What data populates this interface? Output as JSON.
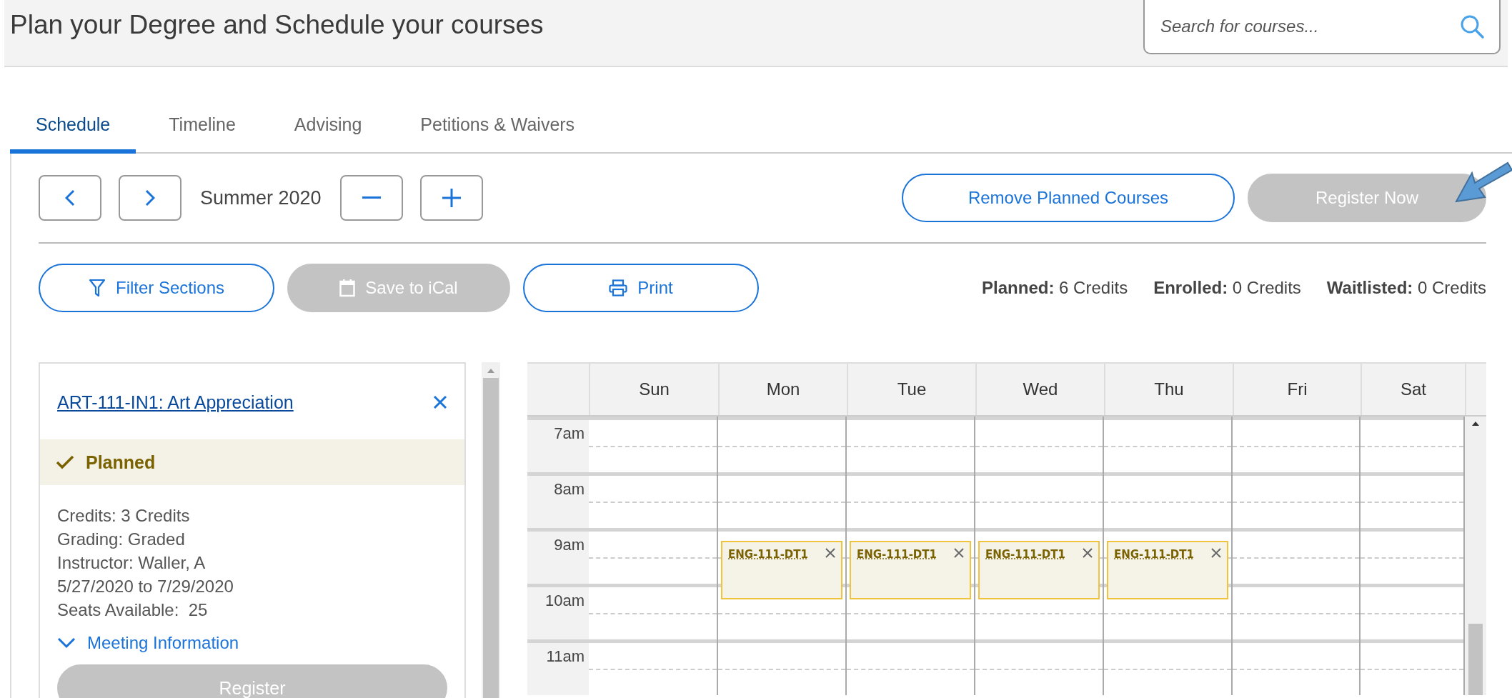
{
  "page_title": "Plan your Degree and Schedule your courses",
  "search": {
    "placeholder": "Search for courses..."
  },
  "tabs": [
    {
      "label": "Schedule",
      "selected": true
    },
    {
      "label": "Timeline",
      "selected": false
    },
    {
      "label": "Advising",
      "selected": false
    },
    {
      "label": "Petitions & Waivers",
      "selected": false
    }
  ],
  "term": "Summer 2020",
  "top_actions": [
    {
      "label": "Remove Planned Courses",
      "disabled": false
    },
    {
      "label": "Register Now",
      "disabled": true
    }
  ],
  "tools": [
    {
      "label": "Filter Sections",
      "kind": "filter",
      "disabled": false
    },
    {
      "label": "Save to iCal",
      "kind": "calendar",
      "disabled": true
    },
    {
      "label": "Print",
      "kind": "print",
      "disabled": false
    }
  ],
  "totals": [
    {
      "label": "Planned:",
      "value": "6 Credits"
    },
    {
      "label": "Enrolled:",
      "value": "0 Credits"
    },
    {
      "label": "Waitlisted:",
      "value": "0 Credits"
    }
  ],
  "course_card": {
    "title": "ART-111-IN1: Art Appreciation",
    "status": "Planned",
    "details": [
      "Credits: 3 Credits",
      "Grading: Graded",
      "Instructor: Waller, A",
      "5/27/2020 to 7/29/2020",
      "Seats Available:  25"
    ],
    "meeting_link": "Meeting Information",
    "expanded": false,
    "register": {
      "label": "Register",
      "disabled": true
    }
  },
  "calendar": {
    "hours": [
      "7am",
      "8am",
      "9am",
      "10am",
      "11am"
    ],
    "days": [
      {
        "label": "Sun"
      },
      {
        "label": "Mon",
        "events": [
          {
            "code": "ENG-111-DT1"
          }
        ]
      },
      {
        "label": "Tue",
        "events": [
          {
            "code": "ENG-111-DT1"
          }
        ]
      },
      {
        "label": "Wed",
        "events": [
          {
            "code": "ENG-111-DT1"
          }
        ]
      },
      {
        "label": "Thu",
        "events": [
          {
            "code": "ENG-111-DT1"
          }
        ]
      },
      {
        "label": "Fri"
      },
      {
        "label": "Sat"
      }
    ]
  }
}
